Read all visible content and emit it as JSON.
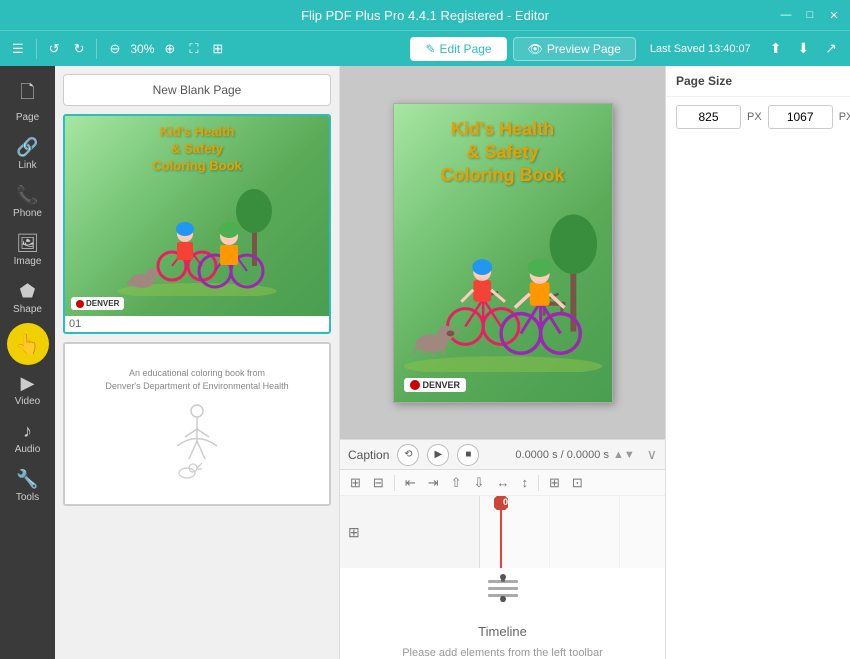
{
  "titlebar": {
    "title": "Flip PDF Plus Pro 4.4.1 Registered - Editor",
    "min_label": "—",
    "max_label": "□",
    "close_label": "✕"
  },
  "toolbar": {
    "undo_label": "↺",
    "redo_label": "↻",
    "zoom_out_label": "⊖",
    "zoom_level": "30%",
    "zoom_in_label": "⊕",
    "fit_label": "⛶",
    "grid_label": "⊞",
    "edit_page_label": "Edit Page",
    "preview_label": "Preview Page",
    "last_saved": "Last Saved 13:40:07",
    "import_label": "⬆",
    "export_label": "⬇",
    "share_label": "↗"
  },
  "sidebar": {
    "items": [
      {
        "id": "page",
        "icon": "🗋",
        "label": "Page"
      },
      {
        "id": "link",
        "icon": "🔗",
        "label": "Link"
      },
      {
        "id": "phone",
        "icon": "📞",
        "label": "Phone"
      },
      {
        "id": "image",
        "icon": "🖼",
        "label": "Image"
      },
      {
        "id": "shape",
        "icon": "⬟",
        "label": "Shape"
      },
      {
        "id": "cursor",
        "icon": "👆",
        "label": ""
      },
      {
        "id": "video",
        "icon": "▶",
        "label": "Video"
      },
      {
        "id": "audio",
        "icon": "♪",
        "label": "Audio"
      },
      {
        "id": "tools",
        "icon": "🔧",
        "label": "Tools"
      }
    ]
  },
  "page_panel": {
    "new_blank_label": "New Blank Page",
    "page1": {
      "num": "01",
      "title_line1": "Kid's Health",
      "title_line2": "& Safety",
      "title_line3": "Coloring Book",
      "badge": "DENVER"
    },
    "page2": {
      "text_line1": "An educational coloring book from",
      "text_line2": "Denver's Department of Environmental Health"
    }
  },
  "canvas": {
    "page": {
      "title_line1": "Kid's Health",
      "title_line2": "& Safety",
      "title_line3": "Coloring Book",
      "badge": "DENVER"
    }
  },
  "right_panel": {
    "page_size_label": "Page Size",
    "width_value": "825",
    "width_unit": "PX",
    "height_value": "1067",
    "height_unit": "PX"
  },
  "timeline": {
    "caption_label": "Caption",
    "rewind_label": "⟲",
    "play_label": "▶",
    "stop_label": "■",
    "time_display": "0.0000 s / 0.0000 s",
    "expand_label": "∨",
    "playhead_num": "0",
    "empty_title": "Timeline",
    "empty_sub": "Please add elements from the left toolbar",
    "toolbar_items": [
      {
        "icon": "⊞",
        "title": "grid"
      },
      {
        "icon": "⊟",
        "title": "remove"
      },
      {
        "icon": "⇤",
        "title": "align-left"
      },
      {
        "icon": "⇥",
        "title": "align-right"
      },
      {
        "icon": "⇧",
        "title": "align-top"
      },
      {
        "icon": "⇩",
        "title": "align-bottom"
      },
      {
        "icon": "↔",
        "title": "distribute-h"
      },
      {
        "icon": "↕",
        "title": "distribute-v"
      },
      {
        "icon": "sep",
        "title": ""
      },
      {
        "icon": "⊞",
        "title": "grid2"
      },
      {
        "icon": "⊡",
        "title": "grid3"
      }
    ]
  }
}
